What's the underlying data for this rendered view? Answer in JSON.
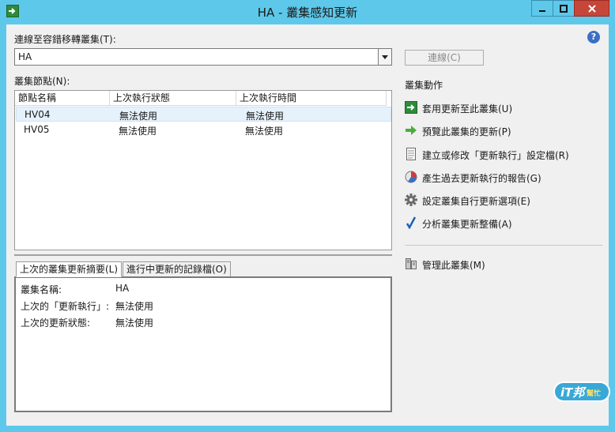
{
  "window": {
    "title": "HA - 叢集感知更新",
    "minimize_label": "—",
    "maximize_label": "□",
    "close_label": "✕"
  },
  "connect": {
    "label": "連線至容錯移轉叢集(T):",
    "value": "HA",
    "button_label": "連線(C)"
  },
  "nodes": {
    "label": "叢集節點(N):",
    "columns": [
      "節點名稱",
      "上次執行狀態",
      "上次執行時間"
    ],
    "rows": [
      {
        "name": "HV04",
        "status": "無法使用",
        "time": "無法使用"
      },
      {
        "name": "HV05",
        "status": "無法使用",
        "time": "無法使用"
      }
    ]
  },
  "tabs": [
    {
      "label": "上次的叢集更新摘要(L)"
    },
    {
      "label": "進行中更新的記錄檔(O)"
    }
  ],
  "summary": [
    {
      "key": "叢集名稱:",
      "value": "HA"
    },
    {
      "key": "上次的「更新執行」:",
      "value": "無法使用"
    },
    {
      "key": "上次的更新狀態:",
      "value": "無法使用"
    }
  ],
  "actions": {
    "title": "叢集動作",
    "items": [
      {
        "label": "套用更新至此叢集(U)",
        "icon": "green-arrow-box-icon"
      },
      {
        "label": "預覽此叢集的更新(P)",
        "icon": "green-arrow-icon"
      },
      {
        "label": "建立或修改「更新執行」設定檔(R)",
        "icon": "document-icon"
      },
      {
        "label": "產生過去更新執行的報告(G)",
        "icon": "report-chart-icon"
      },
      {
        "label": "設定叢集自行更新選項(E)",
        "icon": "gear-icon"
      },
      {
        "label": "分析叢集更新整備(A)",
        "icon": "checkmark-icon"
      }
    ],
    "manage_label": "管理此叢集(M)"
  },
  "watermark": {
    "text": "iT邦",
    "sub": "幫忙"
  },
  "colors": {
    "titlebar": "#5ec8ea",
    "close_button": "#c7463a",
    "selection": "#e5f1fb",
    "green_icon": "#2e8b3a",
    "check_blue": "#1f5fb8"
  }
}
